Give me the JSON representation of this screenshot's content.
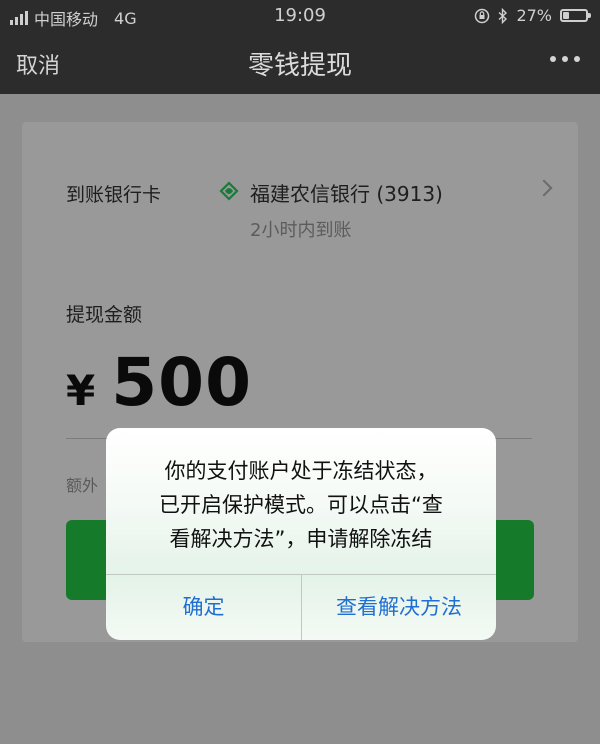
{
  "status_bar": {
    "carrier": "中国移动",
    "network": "4G",
    "time": "19:09",
    "battery": "27%",
    "battery_level": 0.27
  },
  "nav": {
    "cancel": "取消",
    "title": "零钱提现",
    "more_icon": "ellipsis-icon"
  },
  "form": {
    "bank_label": "到账银行卡",
    "bank_name": "福建农信银行 (3913)",
    "arrival_time": "2小时内到账",
    "amount_label": "提现金额",
    "currency": "¥",
    "amount": "500",
    "extra_prefix": "额外"
  },
  "alert": {
    "message_lines": [
      "你的支付账户处于冻结状态，",
      "已开启保护模式。可以点击“查",
      "看解决方法”，申请解除冻结"
    ],
    "confirm": "确定",
    "solution": "查看解决方法"
  },
  "colors": {
    "accent_green": "#157a2a",
    "link_blue": "#1f6fd1",
    "bank_logo_green": "#1a7a3a"
  }
}
